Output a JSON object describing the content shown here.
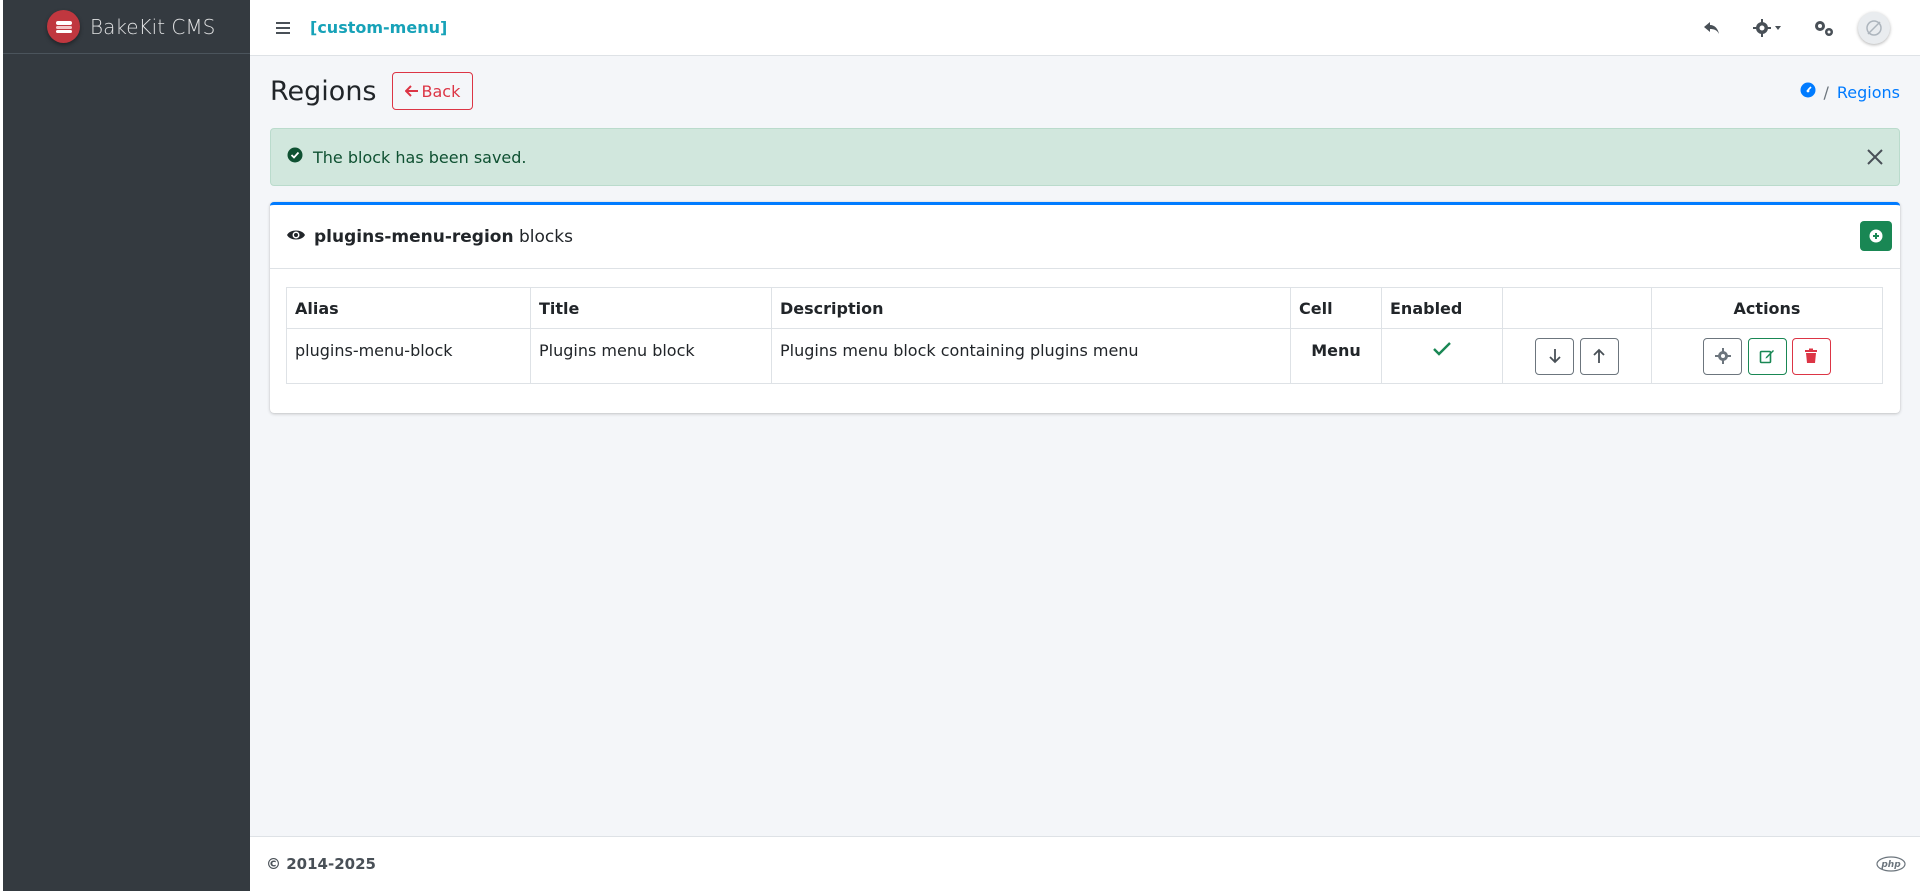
{
  "app": {
    "brand": "BakeKit CMS"
  },
  "navbar": {
    "site_label": "[custom-menu]",
    "icons": [
      "hamburger-icon",
      "reply-icon",
      "gear-icon",
      "gears-icon",
      "avatar"
    ]
  },
  "page": {
    "title": "Regions",
    "back_label": "Back",
    "breadcrumb": [
      "Regions"
    ]
  },
  "alert": {
    "message": "The block has been saved.",
    "type": "success"
  },
  "card": {
    "region_name": "plugins-menu-region",
    "suffix": "blocks"
  },
  "table": {
    "headers": [
      "Alias",
      "Title",
      "Description",
      "Cell",
      "Enabled",
      "",
      "Actions"
    ],
    "rows": [
      {
        "alias": "plugins-menu-block",
        "title": "Plugins menu block",
        "description": "Plugins menu block containing plugins menu",
        "cell": "Menu",
        "enabled": true
      }
    ]
  },
  "footer": {
    "copyright": "© 2014-2025",
    "logo": "php"
  },
  "colors": {
    "sidebar": "#343a40",
    "primary": "#007bff",
    "success": "#198754",
    "danger": "#dc3545",
    "info": "#17a2b8",
    "alert_bg": "#d1e7dd"
  }
}
